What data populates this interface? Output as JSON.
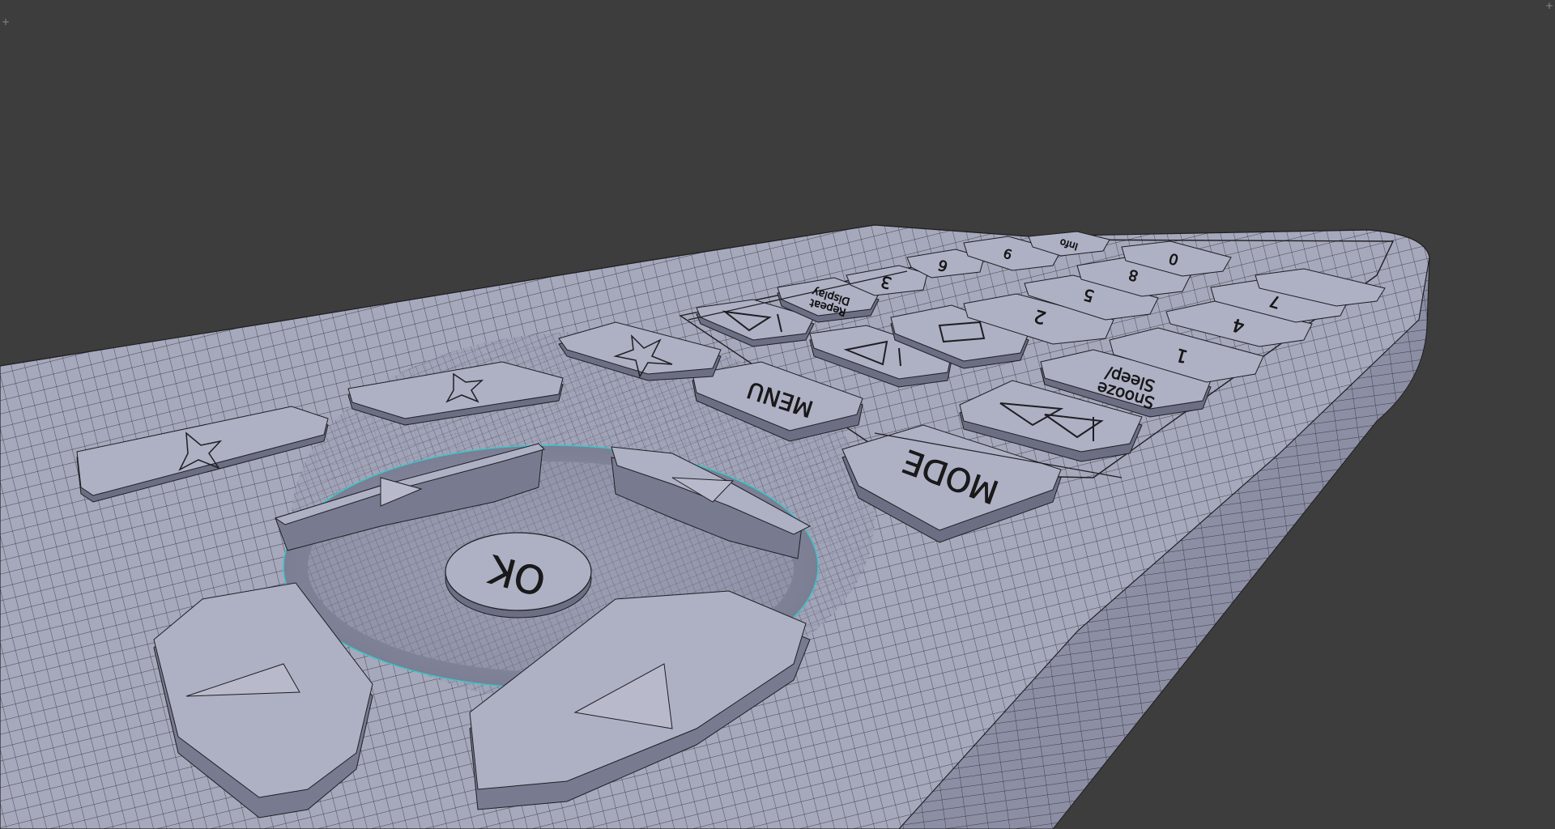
{
  "viewport": {
    "background": "#3d3d3d",
    "mesh_color": "#a6a8bc",
    "wire_color": "#1e1e22",
    "selection_edge_color": "#35c9c9",
    "corner_widgets": [
      "split-area-icon",
      "split-area-icon"
    ]
  },
  "remote": {
    "buttons": {
      "ok": "OK",
      "mode": "MODE",
      "menu": "MENU",
      "sleep_snooze_line1": "Sleep/",
      "sleep_snooze_line2": "Snooze",
      "display_repeat_line1": "Display",
      "display_repeat_line2": "Repeat",
      "num0": "0",
      "num1": "1",
      "num2": "2",
      "num3": "3",
      "num4": "4",
      "num5": "5",
      "num6": "6",
      "num7": "7",
      "num8": "8",
      "num9": "9",
      "top_partial": "Info"
    },
    "icons": {
      "dpad_up": "triangle-up-icon",
      "dpad_down": "triangle-down-icon",
      "dpad_left": "triangle-left-icon",
      "dpad_right": "triangle-right-icon",
      "play_pause": "play-pause-icon",
      "stop": "stop-icon",
      "next": "skip-next-icon",
      "prev": "skip-previous-icon",
      "favorite": "star-icon",
      "preset_add": "star-plus-icon",
      "preset_remove": "star-minus-icon"
    }
  }
}
